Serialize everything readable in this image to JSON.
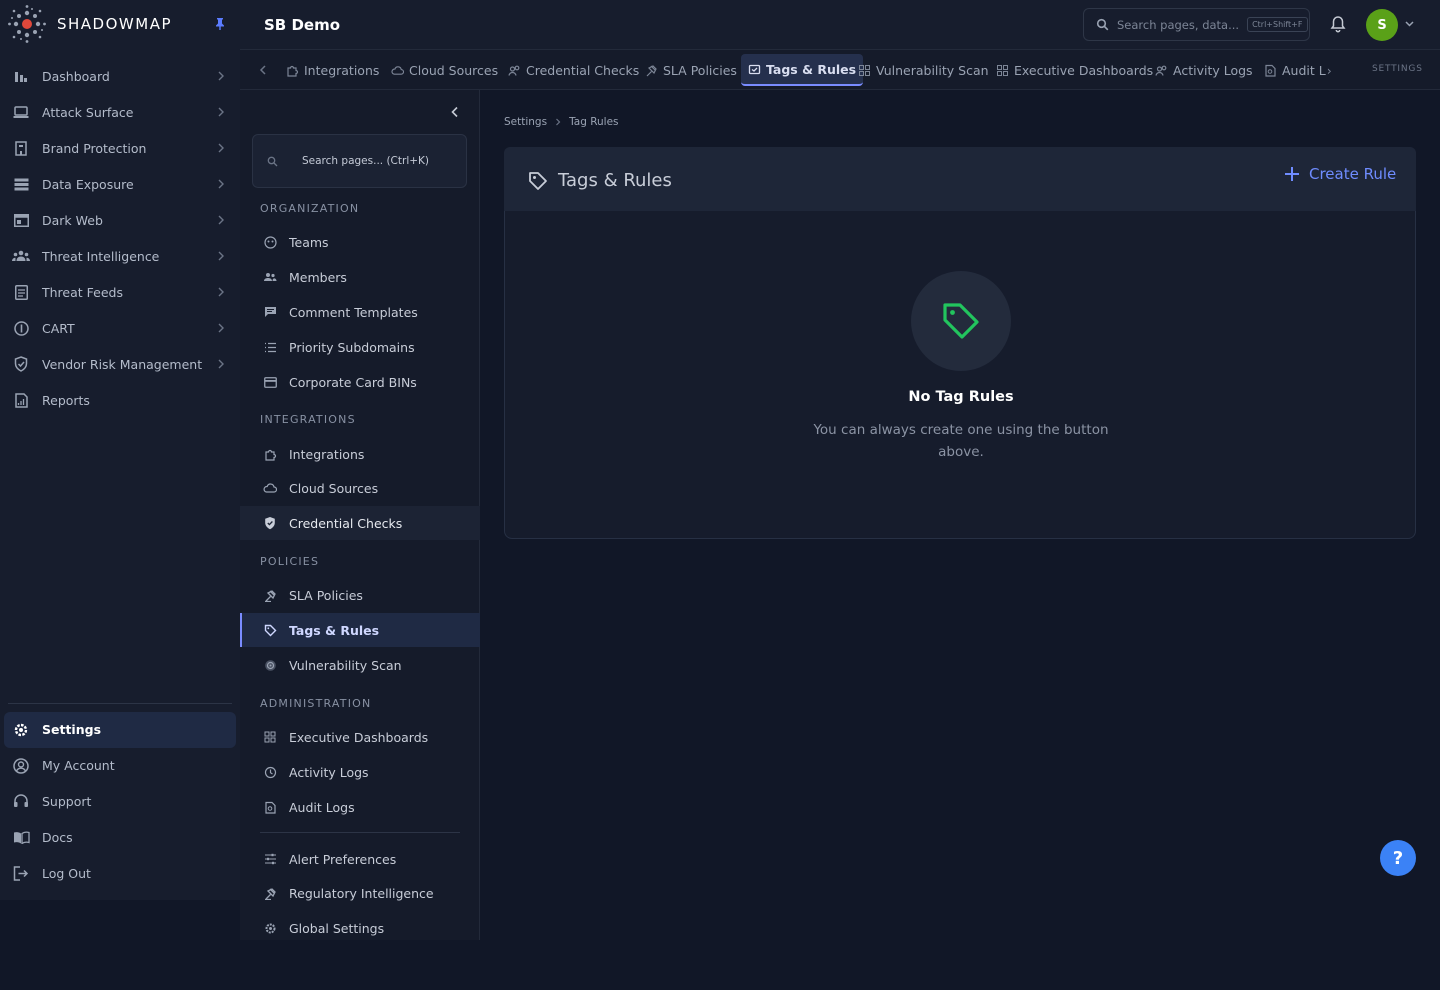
{
  "app": {
    "logo_text": "SHADOWMAP",
    "org_title": "SB Demo"
  },
  "colors": {
    "accent": "#7a8cff",
    "brand_green": "#22c55e",
    "avatar_bg": "#5aa118",
    "help_bg": "#3b82f6"
  },
  "sidebar": {
    "items": [
      {
        "label": "Dashboard",
        "icon": "bar-chart-icon"
      },
      {
        "label": "Attack Surface",
        "icon": "laptop-icon"
      },
      {
        "label": "Brand Protection",
        "icon": "building-icon"
      },
      {
        "label": "Data Exposure",
        "icon": "database-icon"
      },
      {
        "label": "Dark Web",
        "icon": "window-icon"
      },
      {
        "label": "Threat Intelligence",
        "icon": "users-icon"
      },
      {
        "label": "Threat Feeds",
        "icon": "feed-icon"
      },
      {
        "label": "CART",
        "icon": "alert-circle-icon"
      },
      {
        "label": "Vendor Risk Management",
        "icon": "shield-icon"
      },
      {
        "label": "Reports",
        "icon": "report-icon"
      }
    ],
    "bottom": [
      {
        "label": "Settings",
        "icon": "gear-icon"
      },
      {
        "label": "My Account",
        "icon": "user-circle-icon"
      },
      {
        "label": "Support",
        "icon": "headset-icon"
      },
      {
        "label": "Docs",
        "icon": "book-icon"
      },
      {
        "label": "Log Out",
        "icon": "logout-icon"
      }
    ]
  },
  "header": {
    "search_placeholder": "Search pages, data...",
    "search_shortcut": "Ctrl+Shift+F",
    "avatar_initial": "S"
  },
  "tabs": {
    "items": [
      {
        "label": "Integrations",
        "icon": "puzzle-icon"
      },
      {
        "label": "Cloud Sources",
        "icon": "cloud-icon"
      },
      {
        "label": "Credential Checks",
        "icon": "users-icon"
      },
      {
        "label": "SLA Policies",
        "icon": "gavel-icon"
      },
      {
        "label": "Tags & Rules",
        "icon": "tag-icon"
      },
      {
        "label": "Vulnerability Scan",
        "icon": "grid-icon"
      },
      {
        "label": "Executive Dashboards",
        "icon": "grid-icon"
      },
      {
        "label": "Activity Logs",
        "icon": "users-icon"
      },
      {
        "label": "Audit L",
        "icon": "search-doc-icon"
      }
    ],
    "section_label": "SETTINGS"
  },
  "subnav": {
    "search_placeholder": "Search pages... (Ctrl+K)",
    "headings": [
      "ORGANIZATION",
      "INTEGRATIONS",
      "POLICIES",
      "ADMINISTRATION"
    ],
    "organization": [
      "Teams",
      "Members",
      "Comment Templates",
      "Priority Subdomains",
      "Corporate Card BINs"
    ],
    "integrations": [
      "Integrations",
      "Cloud Sources",
      "Credential Checks"
    ],
    "policies": [
      "SLA Policies",
      "Tags & Rules",
      "Vulnerability Scan"
    ],
    "administration": [
      "Executive Dashboards",
      "Activity Logs",
      "Audit Logs"
    ],
    "other": [
      "Alert Preferences",
      "Regulatory Intelligence",
      "Global Settings"
    ]
  },
  "main": {
    "breadcrumb": [
      "Settings",
      "Tag Rules"
    ],
    "title": "Tags & Rules",
    "create_button": "Create Rule",
    "empty_title": "No Tag Rules",
    "empty_desc": "You can always create one using the button above."
  },
  "help_label": "?"
}
